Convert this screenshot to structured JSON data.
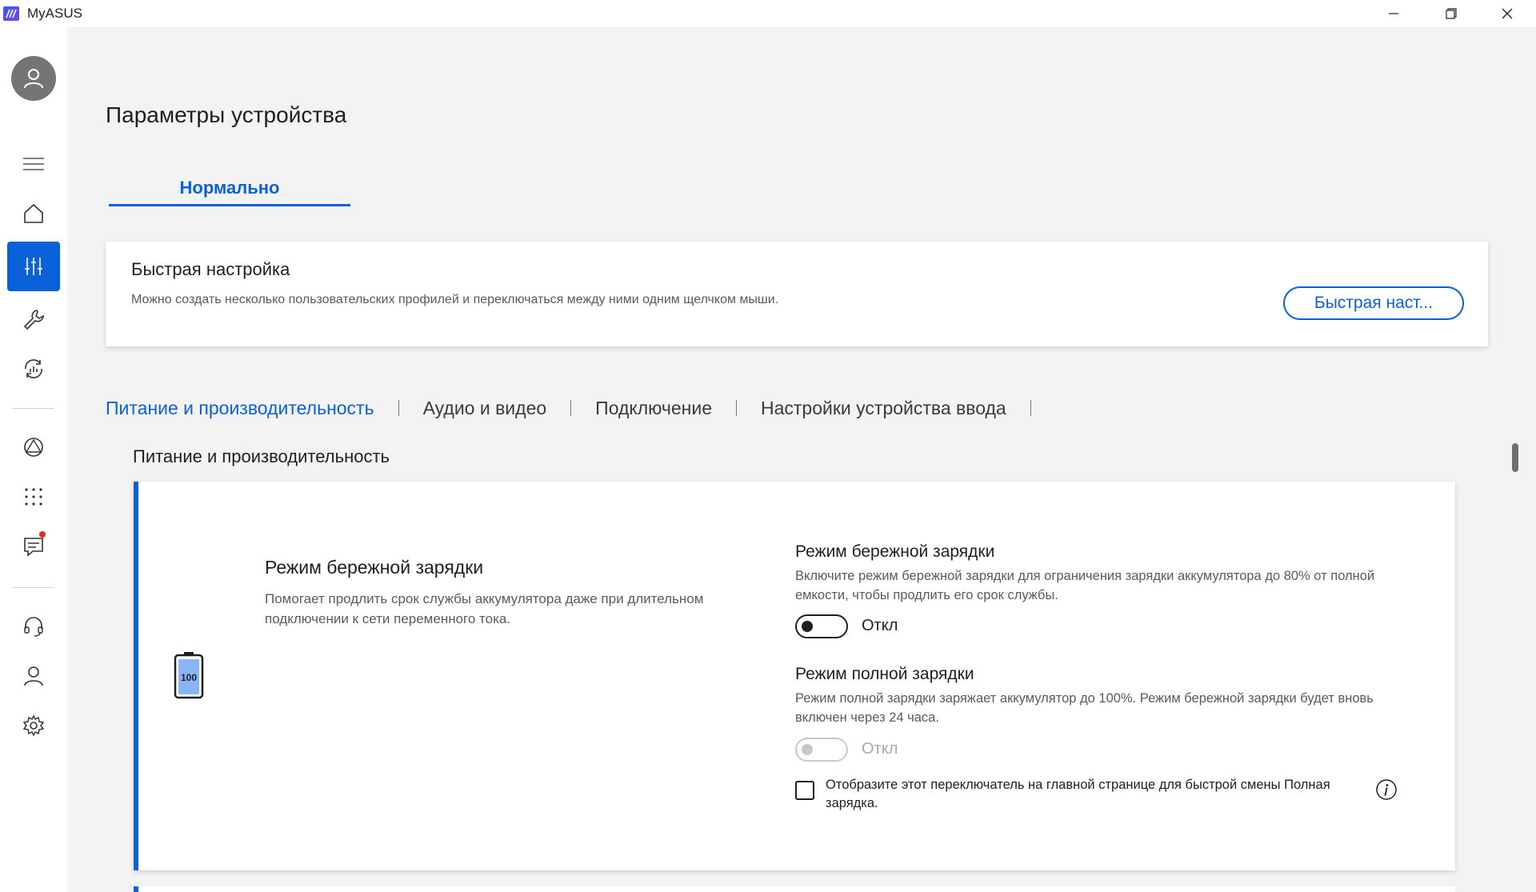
{
  "window": {
    "title": "MyASUS",
    "minimize_icon": "minimize-icon",
    "maximize_icon": "restore-icon",
    "close_icon": "close-icon"
  },
  "sidebar": {
    "items": [
      {
        "icon": "menu-icon"
      },
      {
        "icon": "home-icon"
      },
      {
        "icon": "sliders-icon",
        "active": true
      },
      {
        "icon": "wrench-icon"
      },
      {
        "icon": "sync-icon"
      },
      {
        "icon": "triangle-circle-icon"
      },
      {
        "icon": "grid-dots-icon"
      },
      {
        "icon": "message-icon",
        "badge": true
      },
      {
        "icon": "headset-icon"
      },
      {
        "icon": "user-icon"
      },
      {
        "icon": "gear-icon"
      }
    ],
    "accent_color": "#0a61d9"
  },
  "main": {
    "page_title": "Параметры устройства",
    "mode_tab": "Нормально",
    "quick_setup": {
      "title": "Быстрая настройка",
      "description": "Можно создать несколько пользовательских профилей и переключаться между ними одним щелчком мыши.",
      "button_label": "Быстрая наст..."
    },
    "category_tabs": [
      {
        "label": "Питание и производительность",
        "active": true
      },
      {
        "label": "Аудио и видео"
      },
      {
        "label": "Подключение"
      },
      {
        "label": "Настройки устройства ввода"
      }
    ],
    "section_heading": "Питание и производительность",
    "feature": {
      "icon": "battery-icon",
      "battery_level_text": "100",
      "title": "Режим бережной зарядки",
      "description": "Помогает продлить срок службы аккумулятора даже при длительном подключении к сети переменного тока.",
      "options": [
        {
          "title": "Режим бережной зарядки",
          "description": "Включите режим бережной зарядки для ограничения зарядки аккумулятора до 80% от полной емкости, чтобы продлить его срок службы.",
          "toggle_state": "Откл",
          "enabled": true
        },
        {
          "title": "Режим полной зарядки",
          "description": "Режим полной зарядки заряжает аккумулятор до 100%. Режим бережной зарядки будет вновь включен через 24 часа.",
          "toggle_state": "Откл",
          "enabled": false
        }
      ],
      "checkbox_label": "Отобразите этот переключатель на главной странице для быстрой смены Полная зарядка.",
      "checkbox_checked": false,
      "info_icon": "info-icon"
    }
  }
}
